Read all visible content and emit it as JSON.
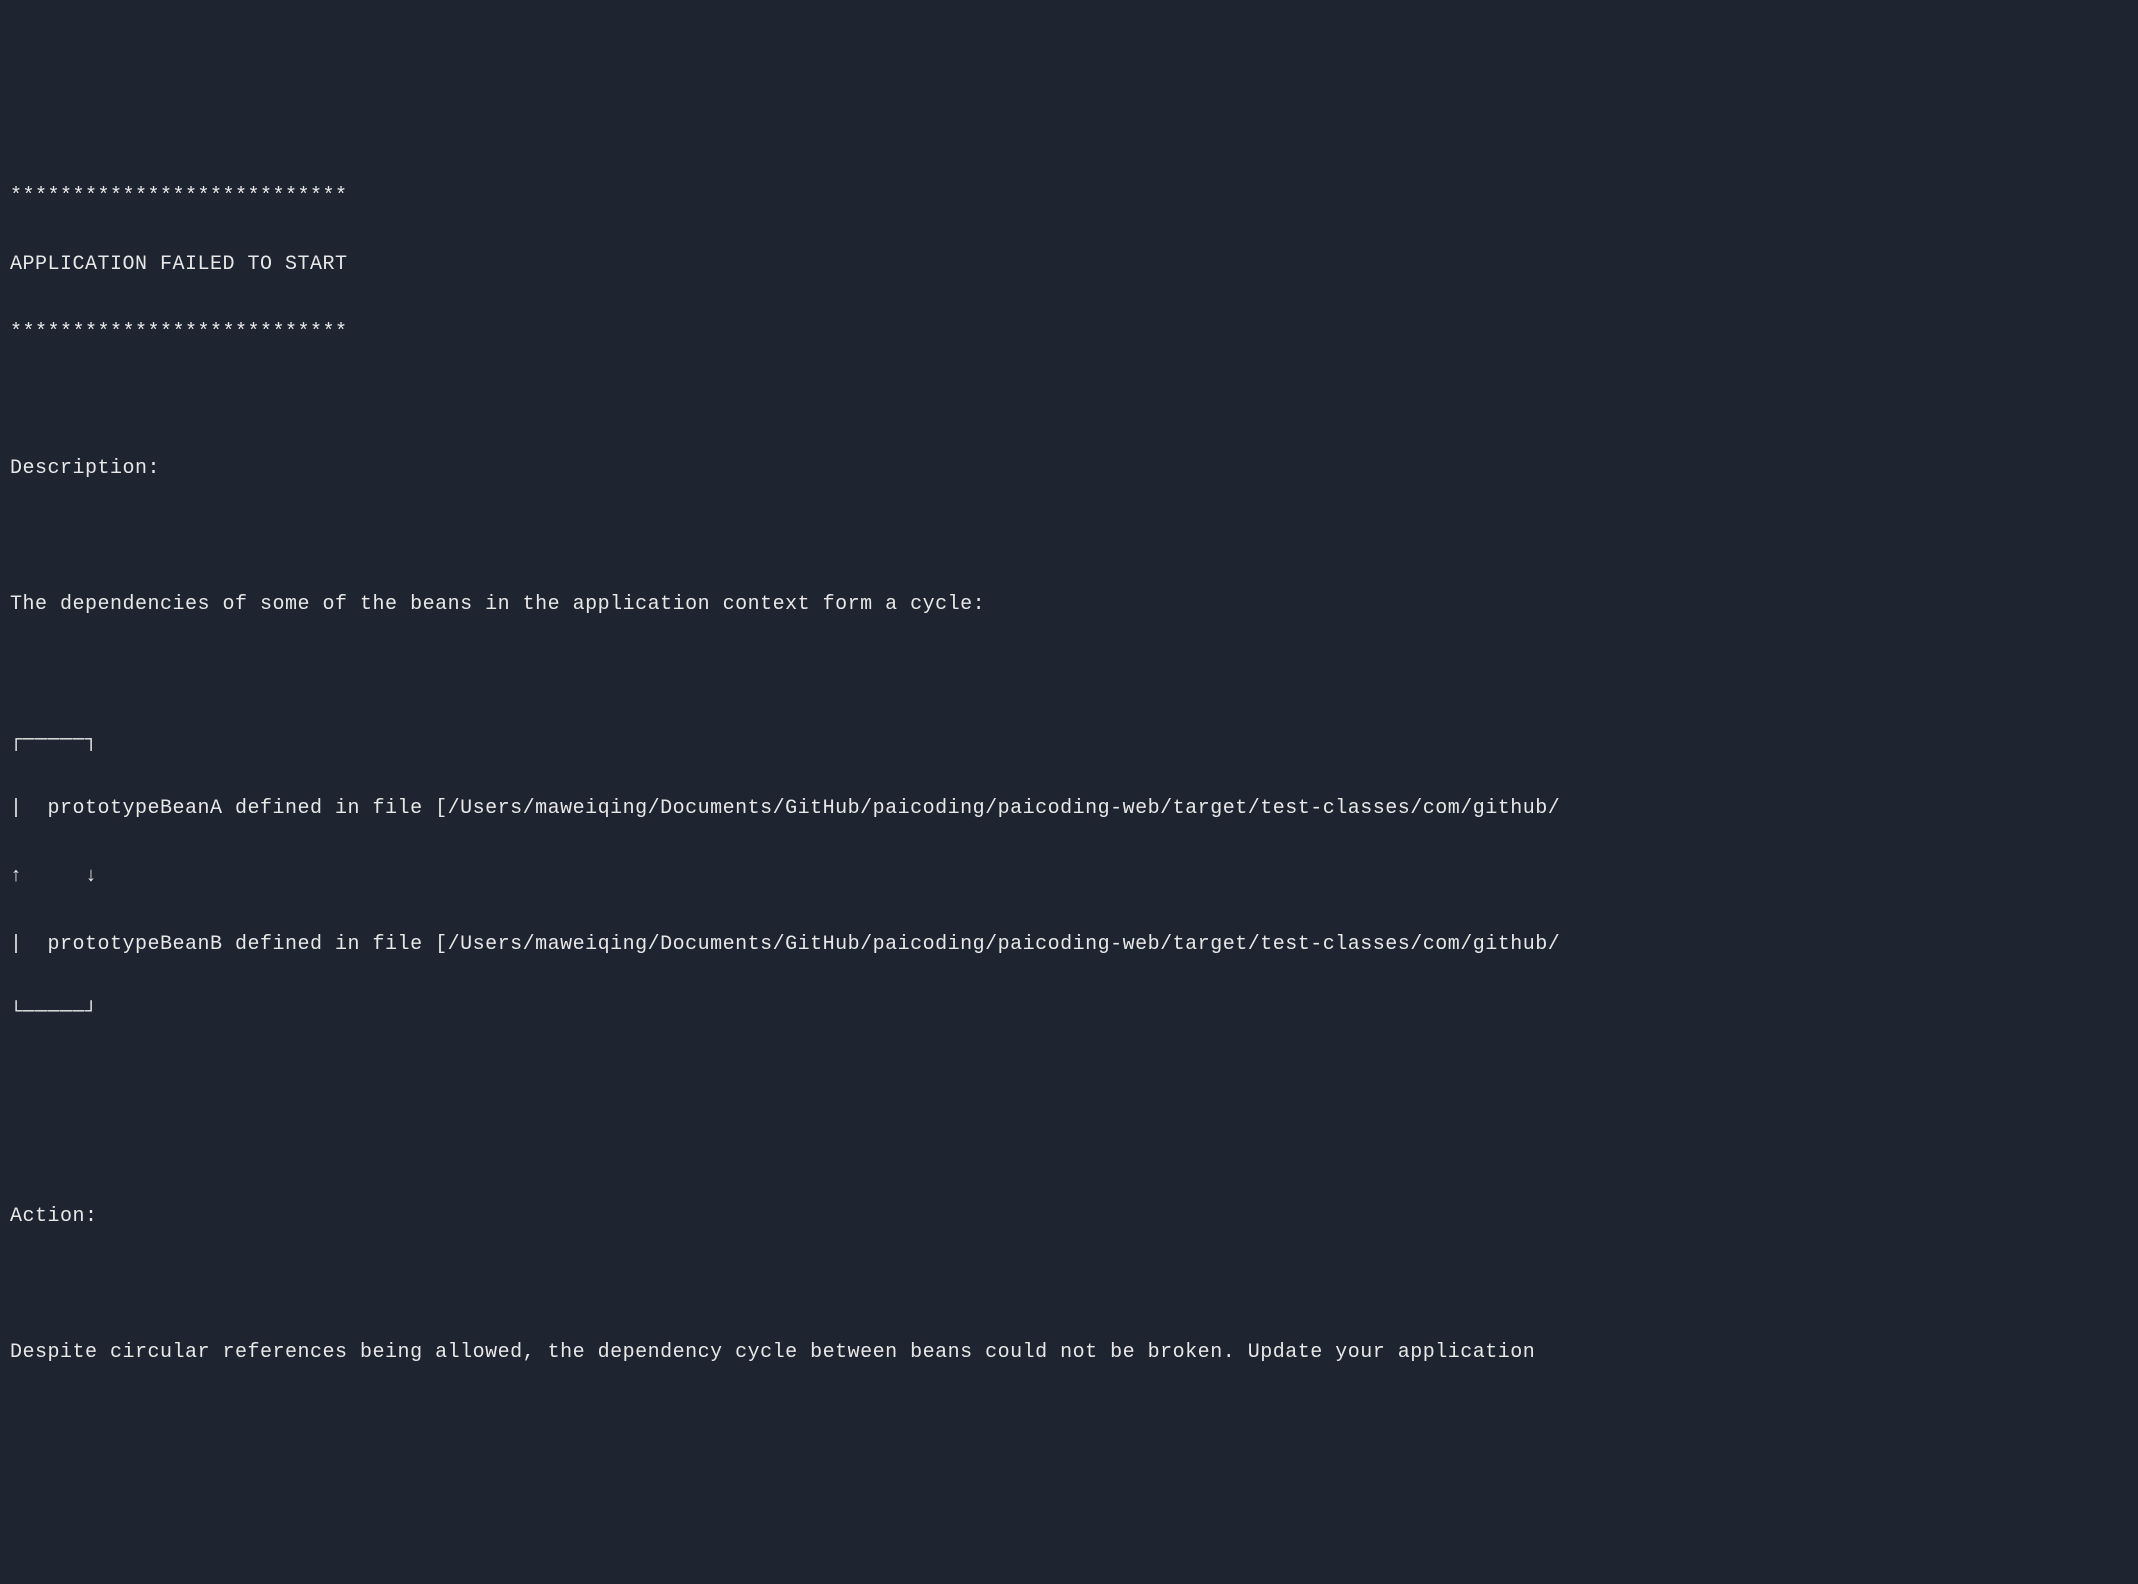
{
  "console": {
    "border_top": "***************************",
    "title": "APPLICATION FAILED TO START",
    "border_bottom": "***************************",
    "description_label": "Description:",
    "description_text": "The dependencies of some of the beans in the application context form a cycle:",
    "cycle": {
      "top": "┌─────┐",
      "beanA": "|  prototypeBeanA defined in file [/Users/maweiqing/Documents/GitHub/paicoding/paicoding-web/target/test-classes/com/github/",
      "arrows": "↑     ↓",
      "beanB": "|  prototypeBeanB defined in file [/Users/maweiqing/Documents/GitHub/paicoding/paicoding-web/target/test-classes/com/github/",
      "bottom": "└─────┘"
    },
    "action_label": "Action:",
    "action_text": "Despite circular references being allowed, the dependency cycle between beans could not be broken. Update your application "
  }
}
